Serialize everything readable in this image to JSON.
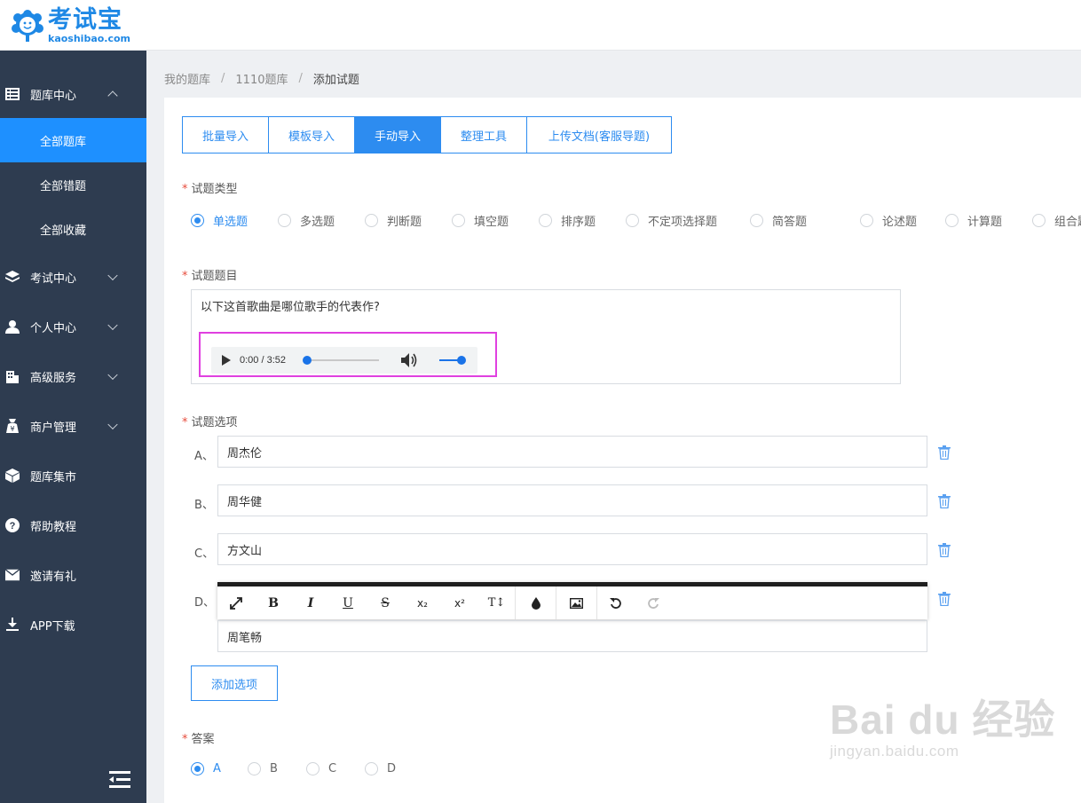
{
  "logo": {
    "cn": "考试宝",
    "en": "kaoshibao.com"
  },
  "sidebar": {
    "items": [
      {
        "label": "题库中心",
        "icon": "list-icon",
        "expanded": true
      },
      {
        "label": "考试中心",
        "icon": "layers-icon"
      },
      {
        "label": "个人中心",
        "icon": "user-icon"
      },
      {
        "label": "高级服务",
        "icon": "building-icon"
      },
      {
        "label": "商户管理",
        "icon": "merchant-icon"
      },
      {
        "label": "题库集市",
        "icon": "cube-icon"
      },
      {
        "label": "帮助教程",
        "icon": "help-icon"
      },
      {
        "label": "邀请有礼",
        "icon": "envelope-icon"
      },
      {
        "label": "APP下载",
        "icon": "download-icon"
      }
    ],
    "sub_items": [
      {
        "label": "全部题库",
        "active": true
      },
      {
        "label": "全部错题"
      },
      {
        "label": "全部收藏"
      }
    ]
  },
  "breadcrumb": {
    "items": [
      "我的题库",
      "1110题库",
      "添加试题"
    ],
    "separator": "/"
  },
  "tabs": [
    {
      "label": "批量导入"
    },
    {
      "label": "模板导入"
    },
    {
      "label": "手动导入",
      "active": true
    },
    {
      "label": "整理工具"
    },
    {
      "label": "上传文档(客服导题)"
    }
  ],
  "question_type": {
    "label": "试题类型",
    "options": [
      "单选题",
      "多选题",
      "判断题",
      "填空题",
      "排序题",
      "不定项选择题",
      "简答题",
      "论述题",
      "计算题",
      "组合题"
    ],
    "selected": "单选题"
  },
  "question": {
    "label": "试题题目",
    "text": "以下这首歌曲是哪位歌手的代表作?",
    "audio": {
      "time": "0:00 / 3:52",
      "progress": 0,
      "volume": 1
    }
  },
  "options_section": {
    "label": "试题选项",
    "options": [
      {
        "letter": "A、",
        "value": "周杰伦"
      },
      {
        "letter": "B、",
        "value": "周华健"
      },
      {
        "letter": "C、",
        "value": "方文山"
      },
      {
        "letter": "D、",
        "value": "周笔畅"
      }
    ],
    "add_label": "添加选项"
  },
  "editor_toolbar": {
    "buttons": [
      "fullscreen-icon",
      "bold-icon",
      "italic-icon",
      "underline-icon",
      "strikethrough-icon",
      "subscript-icon",
      "superscript-icon",
      "font-size-icon",
      "color-drop-icon",
      "image-icon",
      "undo-icon",
      "redo-icon"
    ],
    "bold": "B",
    "italic": "I",
    "underline": "U",
    "strike": "S",
    "sub": "x₂",
    "sup": "x²",
    "fontsize": "T↕"
  },
  "answer": {
    "label": "答案",
    "options": [
      "A",
      "B",
      "C",
      "D"
    ],
    "selected": "A"
  },
  "watermark": {
    "main": "Bai du 经验",
    "sub": "jingyan.baidu.com"
  },
  "colors": {
    "accent": "#2d8cf0",
    "sidebar": "#2e3c50",
    "active_nav": "#1e90ff",
    "highlight": "#e040e0"
  }
}
